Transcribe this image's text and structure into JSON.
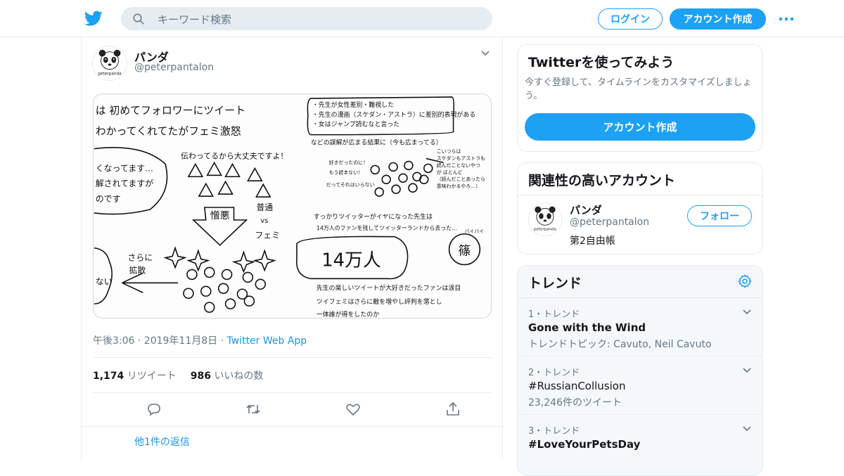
{
  "colors": {
    "accent": "#1da1f2",
    "link": "#1b95e0",
    "muted": "#657786",
    "border": "#e6ecf0"
  },
  "header": {
    "logo_icon": "twitter-bird-icon",
    "search_placeholder": "キーワード検索",
    "login_label": "ログイン",
    "signup_label": "アカウント作成",
    "more_icon": "more-dots-icon"
  },
  "tweet": {
    "author_name": "パンダ",
    "author_handle": "@peterpantalon",
    "avatar_label": "peterpanda",
    "timestamp": "午後3:06 · 2019年11月8日",
    "separator": " · ",
    "source": "Twitter Web App",
    "retweet_count": "1,174",
    "retweet_label": "リツイート",
    "like_count": "986",
    "like_label": "いいねの数",
    "more_replies": "他1件の返信",
    "image_text": {
      "title1": "は 初めてフォロワーにツイート",
      "title2": "わかってくれてたがフェミ激怒",
      "bubble": [
        "・先生が女性差別・難視した",
        "・先生の漫画（スケダン・アストラ）に差別的表現がある",
        "・女はジャンプ読むなと言った"
      ],
      "rumor": "などの誤解が広まる結果に（今も広まってる）",
      "ok": "伝わってるから大丈夫ですよ！",
      "left_bubble": [
        "くなってます…",
        "解されてますが",
        "のです"
      ],
      "hate": "憎悪",
      "vs1": "普通",
      "vs": "vs",
      "vs2": "フェミ",
      "spread1": "さらに",
      "spread2": "拡散",
      "left_small": "ない",
      "fans": "好きだったのに！",
      "fans2": "もう読まない！",
      "fans3": "だってそれはいらない",
      "notes": [
        "こいつらは",
        "スケダンもアストラも",
        "読んだことないやつ",
        "が ほとんど",
        "（読んだことあったら",
        "意味わかるやろ…）"
      ],
      "quit": "すっかりツイッターがイヤになった先生は",
      "quit2": "14万人のファンを残してツイッターランドから去った…",
      "count": "14万人",
      "bye": "バイバイ",
      "shino": "篠",
      "fans_sad": "先生の楽しいツイートが大好きだったファンは涙目",
      "twifemi": "ツイフェミはさらに敵を増やし評判を落とし",
      "last": "一体誰が得をしたのか"
    }
  },
  "sidebar": {
    "try_title": "Twitterを使ってみよう",
    "try_desc": "今すぐ登録して、タイムラインをカスタマイズしましょう。",
    "try_button": "アカウント作成",
    "related_title": "関連性の高いアカウント",
    "related": {
      "name": "パンダ",
      "handle": "@peterpantalon",
      "bio": "第2自由帳",
      "follow": "フォロー"
    },
    "trends_title": "トレンド",
    "trends": [
      {
        "meta": "1・トレンド",
        "title": "Gone with the Wind",
        "sub": "トレンドトピック: Cavuto, Neil Cavuto"
      },
      {
        "meta": "2・トレンド",
        "title": "#RussianCollusion",
        "sub": "23,246件のツイート"
      },
      {
        "meta": "3・トレンド",
        "title": "#LoveYourPetsDay",
        "sub": ""
      }
    ]
  }
}
